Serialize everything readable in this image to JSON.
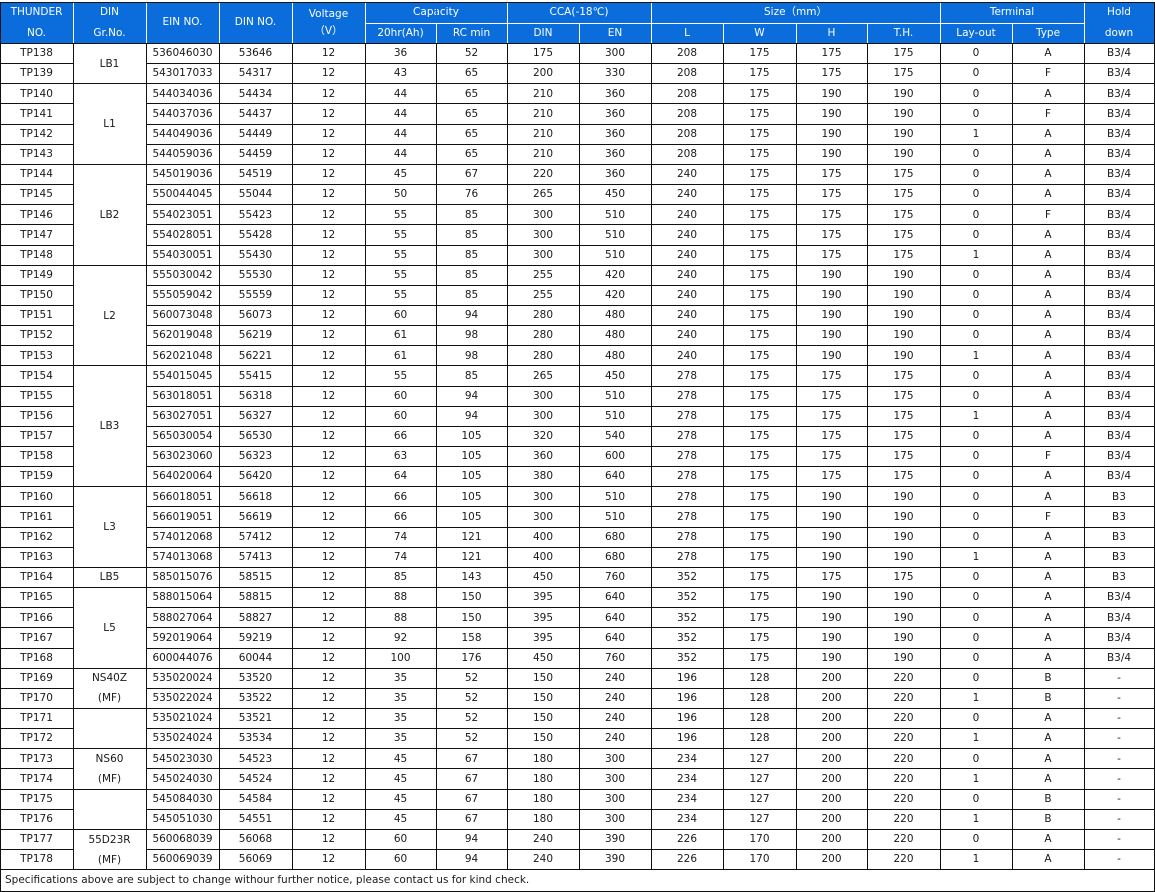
{
  "header": {
    "thunder": "THUNDER",
    "no": "NO.",
    "din": "DIN",
    "gr_no": "Gr.No.",
    "ein_no": "EIN NO.",
    "din_no": "DIN NO.",
    "voltage": "Voltage",
    "voltage_unit": "（V）",
    "capacity": "Capacity",
    "cap_20hr": "20hr(Ah)",
    "cap_rc": "RC min",
    "cca": "CCA(-18℃)",
    "cca_din": "DIN",
    "cca_en": "EN",
    "size": "Size（mm）",
    "size_l": "L",
    "size_w": "W",
    "size_h": "H",
    "size_th": "T.H.",
    "terminal": "Terminal",
    "layout": "Lay-out",
    "type": "Type",
    "hold": "Hold",
    "down": "down"
  },
  "groups": [
    {
      "label": "LB1",
      "start": 0,
      "span": 2
    },
    {
      "label": "L1",
      "start": 2,
      "span": 4
    },
    {
      "label": "LB2",
      "start": 6,
      "span": 5
    },
    {
      "label": "L2",
      "start": 11,
      "span": 5
    },
    {
      "label": "LB3",
      "start": 16,
      "span": 6
    },
    {
      "label": "L3",
      "start": 22,
      "span": 4
    },
    {
      "label": "LB5",
      "start": 26,
      "span": 1
    },
    {
      "label": "L5",
      "start": 27,
      "span": 4
    },
    {
      "label": "NS40Z\n(MF)",
      "start": 31,
      "span": 2
    },
    {
      "label": "",
      "start": 33,
      "span": 2
    },
    {
      "label": "NS60\n(MF)",
      "start": 35,
      "span": 2
    },
    {
      "label": "",
      "start": 37,
      "span": 2
    },
    {
      "label": "55D23R\n(MF)",
      "start": 39,
      "span": 2
    }
  ],
  "rows": [
    [
      "TP138",
      "536046030",
      "53646",
      "12",
      "36",
      "52",
      "175",
      "300",
      "208",
      "175",
      "175",
      "175",
      "0",
      "A",
      "B3/4"
    ],
    [
      "TP139",
      "543017033",
      "54317",
      "12",
      "43",
      "65",
      "200",
      "330",
      "208",
      "175",
      "175",
      "175",
      "0",
      "F",
      "B3/4"
    ],
    [
      "TP140",
      "544034036",
      "54434",
      "12",
      "44",
      "65",
      "210",
      "360",
      "208",
      "175",
      "190",
      "190",
      "0",
      "A",
      "B3/4"
    ],
    [
      "TP141",
      "544037036",
      "54437",
      "12",
      "44",
      "65",
      "210",
      "360",
      "208",
      "175",
      "190",
      "190",
      "0",
      "F",
      "B3/4"
    ],
    [
      "TP142",
      "544049036",
      "54449",
      "12",
      "44",
      "65",
      "210",
      "360",
      "208",
      "175",
      "190",
      "190",
      "1",
      "A",
      "B3/4"
    ],
    [
      "TP143",
      "544059036",
      "54459",
      "12",
      "44",
      "65",
      "210",
      "360",
      "208",
      "175",
      "190",
      "190",
      "0",
      "A",
      "B3/4"
    ],
    [
      "TP144",
      "545019036",
      "54519",
      "12",
      "45",
      "67",
      "220",
      "360",
      "240",
      "175",
      "175",
      "175",
      "0",
      "A",
      "B3/4"
    ],
    [
      "TP145",
      "550044045",
      "55044",
      "12",
      "50",
      "76",
      "265",
      "450",
      "240",
      "175",
      "175",
      "175",
      "0",
      "A",
      "B3/4"
    ],
    [
      "TP146",
      "554023051",
      "55423",
      "12",
      "55",
      "85",
      "300",
      "510",
      "240",
      "175",
      "175",
      "175",
      "0",
      "F",
      "B3/4"
    ],
    [
      "TP147",
      "554028051",
      "55428",
      "12",
      "55",
      "85",
      "300",
      "510",
      "240",
      "175",
      "175",
      "175",
      "0",
      "A",
      "B3/4"
    ],
    [
      "TP148",
      "554030051",
      "55430",
      "12",
      "55",
      "85",
      "300",
      "510",
      "240",
      "175",
      "175",
      "175",
      "1",
      "A",
      "B3/4"
    ],
    [
      "TP149",
      "555030042",
      "55530",
      "12",
      "55",
      "85",
      "255",
      "420",
      "240",
      "175",
      "190",
      "190",
      "0",
      "A",
      "B3/4"
    ],
    [
      "TP150",
      "555059042",
      "55559",
      "12",
      "55",
      "85",
      "255",
      "420",
      "240",
      "175",
      "190",
      "190",
      "0",
      "A",
      "B3/4"
    ],
    [
      "TP151",
      "560073048",
      "56073",
      "12",
      "60",
      "94",
      "280",
      "480",
      "240",
      "175",
      "190",
      "190",
      "0",
      "A",
      "B3/4"
    ],
    [
      "TP152",
      "562019048",
      "56219",
      "12",
      "61",
      "98",
      "280",
      "480",
      "240",
      "175",
      "190",
      "190",
      "0",
      "A",
      "B3/4"
    ],
    [
      "TP153",
      "562021048",
      "56221",
      "12",
      "61",
      "98",
      "280",
      "480",
      "240",
      "175",
      "190",
      "190",
      "1",
      "A",
      "B3/4"
    ],
    [
      "TP154",
      "554015045",
      "55415",
      "12",
      "55",
      "85",
      "265",
      "450",
      "278",
      "175",
      "175",
      "175",
      "0",
      "A",
      "B3/4"
    ],
    [
      "TP155",
      "563018051",
      "56318",
      "12",
      "60",
      "94",
      "300",
      "510",
      "278",
      "175",
      "175",
      "175",
      "0",
      "A",
      "B3/4"
    ],
    [
      "TP156",
      "563027051",
      "56327",
      "12",
      "60",
      "94",
      "300",
      "510",
      "278",
      "175",
      "175",
      "175",
      "1",
      "A",
      "B3/4"
    ],
    [
      "TP157",
      "565030054",
      "56530",
      "12",
      "66",
      "105",
      "320",
      "540",
      "278",
      "175",
      "175",
      "175",
      "0",
      "A",
      "B3/4"
    ],
    [
      "TP158",
      "563023060",
      "56323",
      "12",
      "63",
      "105",
      "360",
      "600",
      "278",
      "175",
      "175",
      "175",
      "0",
      "F",
      "B3/4"
    ],
    [
      "TP159",
      "564020064",
      "56420",
      "12",
      "64",
      "105",
      "380",
      "640",
      "278",
      "175",
      "175",
      "175",
      "0",
      "A",
      "B3/4"
    ],
    [
      "TP160",
      "566018051",
      "56618",
      "12",
      "66",
      "105",
      "300",
      "510",
      "278",
      "175",
      "190",
      "190",
      "0",
      "A",
      "B3"
    ],
    [
      "TP161",
      "566019051",
      "56619",
      "12",
      "66",
      "105",
      "300",
      "510",
      "278",
      "175",
      "190",
      "190",
      "0",
      "F",
      "B3"
    ],
    [
      "TP162",
      "574012068",
      "57412",
      "12",
      "74",
      "121",
      "400",
      "680",
      "278",
      "175",
      "190",
      "190",
      "0",
      "A",
      "B3"
    ],
    [
      "TP163",
      "574013068",
      "57413",
      "12",
      "74",
      "121",
      "400",
      "680",
      "278",
      "175",
      "190",
      "190",
      "1",
      "A",
      "B3"
    ],
    [
      "TP164",
      "585015076",
      "58515",
      "12",
      "85",
      "143",
      "450",
      "760",
      "352",
      "175",
      "175",
      "175",
      "0",
      "A",
      "B3"
    ],
    [
      "TP165",
      "588015064",
      "58815",
      "12",
      "88",
      "150",
      "395",
      "640",
      "352",
      "175",
      "190",
      "190",
      "0",
      "A",
      "B3/4"
    ],
    [
      "TP166",
      "588027064",
      "58827",
      "12",
      "88",
      "150",
      "395",
      "640",
      "352",
      "175",
      "190",
      "190",
      "0",
      "A",
      "B3/4"
    ],
    [
      "TP167",
      "592019064",
      "59219",
      "12",
      "92",
      "158",
      "395",
      "640",
      "352",
      "175",
      "190",
      "190",
      "0",
      "A",
      "B3/4"
    ],
    [
      "TP168",
      "600044076",
      "60044",
      "12",
      "100",
      "176",
      "450",
      "760",
      "352",
      "175",
      "190",
      "190",
      "0",
      "A",
      "B3/4"
    ],
    [
      "TP169",
      "535020024",
      "53520",
      "12",
      "35",
      "52",
      "150",
      "240",
      "196",
      "128",
      "200",
      "220",
      "0",
      "B",
      "-"
    ],
    [
      "TP170",
      "535022024",
      "53522",
      "12",
      "35",
      "52",
      "150",
      "240",
      "196",
      "128",
      "200",
      "220",
      "1",
      "B",
      "-"
    ],
    [
      "TP171",
      "535021024",
      "53521",
      "12",
      "35",
      "52",
      "150",
      "240",
      "196",
      "128",
      "200",
      "220",
      "0",
      "A",
      "-"
    ],
    [
      "TP172",
      "535024024",
      "53534",
      "12",
      "35",
      "52",
      "150",
      "240",
      "196",
      "128",
      "200",
      "220",
      "1",
      "A",
      "-"
    ],
    [
      "TP173",
      "545023030",
      "54523",
      "12",
      "45",
      "67",
      "180",
      "300",
      "234",
      "127",
      "200",
      "220",
      "0",
      "A",
      "-"
    ],
    [
      "TP174",
      "545024030",
      "54524",
      "12",
      "45",
      "67",
      "180",
      "300",
      "234",
      "127",
      "200",
      "220",
      "1",
      "A",
      "-"
    ],
    [
      "TP175",
      "545084030",
      "54584",
      "12",
      "45",
      "67",
      "180",
      "300",
      "234",
      "127",
      "200",
      "220",
      "0",
      "B",
      "-"
    ],
    [
      "TP176",
      "545051030",
      "54551",
      "12",
      "45",
      "67",
      "180",
      "300",
      "234",
      "127",
      "200",
      "220",
      "1",
      "B",
      "-"
    ],
    [
      "TP177",
      "560068039",
      "56068",
      "12",
      "60",
      "94",
      "240",
      "390",
      "226",
      "170",
      "200",
      "220",
      "0",
      "A",
      "-"
    ],
    [
      "TP178",
      "560069039",
      "56069",
      "12",
      "60",
      "94",
      "240",
      "390",
      "226",
      "170",
      "200",
      "220",
      "1",
      "A",
      "-"
    ]
  ],
  "footer": "Specifications above are subject to change withour further notice, please contact us for kind check.",
  "colors": {
    "header_bg": "#0b6ddb",
    "header_text": "#ffffff",
    "grid": "#111111"
  }
}
